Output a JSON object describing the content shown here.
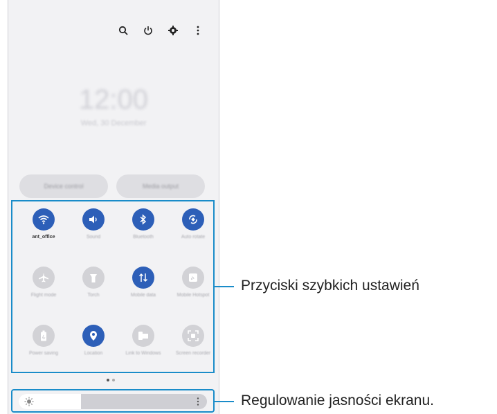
{
  "top_icons": [
    "search-icon",
    "power-icon",
    "settings-gear-icon",
    "more-vertical-icon"
  ],
  "clock": {
    "time": "12:00",
    "date": "Wed, 30 December"
  },
  "panel_buttons": {
    "device_control": "Device control",
    "media_output": "Media output"
  },
  "tiles": [
    {
      "label": "ant_office",
      "state": "on",
      "icon": "wifi-icon"
    },
    {
      "label": "Sound",
      "state": "on",
      "icon": "sound-icon"
    },
    {
      "label": "Bluetooth",
      "state": "on",
      "icon": "bluetooth-icon"
    },
    {
      "label": "Auto rotate",
      "state": "on",
      "icon": "auto-rotate-icon"
    },
    {
      "label": "Flight mode",
      "state": "off",
      "icon": "airplane-icon"
    },
    {
      "label": "Torch",
      "state": "off",
      "icon": "torch-icon"
    },
    {
      "label": "Mobile data",
      "state": "on",
      "icon": "mobile-data-icon"
    },
    {
      "label": "Mobile Hotspot",
      "state": "off",
      "icon": "hotspot-icon"
    },
    {
      "label": "Power saving",
      "state": "off",
      "icon": "power-saving-icon"
    },
    {
      "label": "Location",
      "state": "on",
      "icon": "location-icon"
    },
    {
      "label": "Link to Windows",
      "state": "off",
      "icon": "link-to-windows-icon"
    },
    {
      "label": "Screen recorder",
      "state": "off",
      "icon": "screen-recorder-icon"
    }
  ],
  "page_indicator": {
    "pages": 2,
    "current": 1
  },
  "brightness": {
    "level": 0.33
  },
  "callouts": {
    "quick_settings": "Przyciski szybkich ustawień",
    "brightness": "Regulowanie jasności ekranu."
  },
  "colors": {
    "accent": "#2d5fb8",
    "callout": "#1a8cc9",
    "panel_bg": "#f2f2f4"
  }
}
